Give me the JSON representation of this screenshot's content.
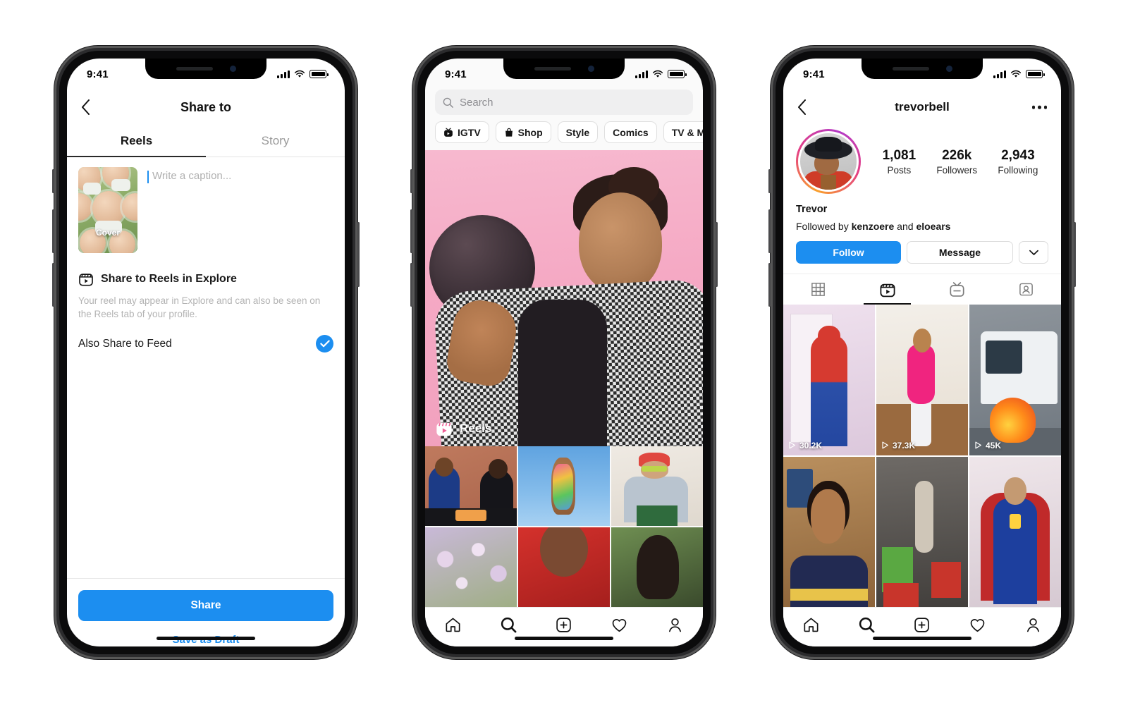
{
  "phones": [
    {
      "id": "share-to",
      "status": {
        "time": "9:41",
        "signal_icon": "cellular-bars-icon",
        "wifi_icon": "wifi-icon",
        "battery_icon": "battery-icon"
      },
      "nav": {
        "title": "Share to",
        "back_icon": "back-chevron-icon"
      },
      "tabs": [
        {
          "label": "Reels",
          "active": true
        },
        {
          "label": "Story",
          "active": false
        }
      ],
      "compose": {
        "cover_label": "Cover",
        "caption_placeholder": "Write a caption...",
        "caption_value": ""
      },
      "explore": {
        "icon": "reels-clapper-icon",
        "title": "Share to Reels in Explore",
        "description": "Your reel may appear in Explore and can also be seen on the Reels tab of your profile.",
        "feed_label": "Also Share to Feed",
        "feed_checked": true,
        "check_icon": "check-circle-icon"
      },
      "footer": {
        "share_label": "Share",
        "draft_label": "Save as Draft"
      }
    },
    {
      "id": "explore",
      "status": {
        "time": "9:41",
        "signal_icon": "cellular-bars-icon",
        "wifi_icon": "wifi-icon",
        "battery_icon": "battery-icon"
      },
      "search": {
        "placeholder": "Search",
        "value": "",
        "icon": "search-icon"
      },
      "chips": [
        {
          "label": "IGTV",
          "icon": "igtv-icon"
        },
        {
          "label": "Shop",
          "icon": "shop-bag-icon"
        },
        {
          "label": "Style",
          "icon": ""
        },
        {
          "label": "Comics",
          "icon": ""
        },
        {
          "label": "TV & Movies",
          "icon": ""
        }
      ],
      "hero": {
        "badge_label": "Reels",
        "badge_icon": "reels-clapper-icon",
        "alt": "person balancing basketball on finger against pink background"
      },
      "grid": [
        {
          "name": "thumb-brick-desk"
        },
        {
          "name": "thumb-glitter-hand-sky"
        },
        {
          "name": "thumb-denim-beanie"
        },
        {
          "name": "thumb-flowers"
        },
        {
          "name": "thumb-red"
        },
        {
          "name": "thumb-dark"
        }
      ],
      "tabbar": [
        {
          "icon": "home-icon",
          "active": false
        },
        {
          "icon": "search-icon",
          "active": true
        },
        {
          "icon": "add-box-icon",
          "active": false
        },
        {
          "icon": "heart-icon",
          "active": false
        },
        {
          "icon": "profile-icon",
          "active": false
        }
      ]
    },
    {
      "id": "profile",
      "status": {
        "time": "9:41",
        "signal_icon": "cellular-bars-icon",
        "wifi_icon": "wifi-icon",
        "battery_icon": "battery-icon"
      },
      "nav": {
        "username": "trevorbell",
        "back_icon": "back-chevron-icon",
        "more_icon": "more-options-icon"
      },
      "stats": [
        {
          "value": "1,081",
          "label": "Posts"
        },
        {
          "value": "226k",
          "label": "Followers"
        },
        {
          "value": "2,943",
          "label": "Following"
        }
      ],
      "bio": {
        "display_name": "Trevor",
        "followed_by_prefix": "Followed by ",
        "followed_by_user1": "kenzoere",
        "followed_by_join": " and ",
        "followed_by_user2": "eloears"
      },
      "actions": {
        "follow_label": "Follow",
        "message_label": "Message",
        "chevron_icon": "chevron-down-icon"
      },
      "profile_tabs": [
        {
          "icon": "grid-icon",
          "active": false
        },
        {
          "icon": "reels-clapper-icon",
          "active": true
        },
        {
          "icon": "igtv-icon",
          "active": false
        },
        {
          "icon": "tagged-person-icon",
          "active": false
        }
      ],
      "reels": [
        {
          "views": "30.2K",
          "name": "reel-spiderman"
        },
        {
          "views": "37.3K",
          "name": "reel-workout-dance"
        },
        {
          "views": "45K",
          "name": "reel-bus-flame"
        },
        {
          "views": "",
          "name": "reel-selfie-talking"
        },
        {
          "views": "",
          "name": "reel-gym-box-jump"
        },
        {
          "views": "",
          "name": "reel-superman-cosplay"
        }
      ],
      "tabbar": [
        {
          "icon": "home-icon",
          "active": false
        },
        {
          "icon": "search-icon",
          "active": true
        },
        {
          "icon": "add-box-icon",
          "active": false
        },
        {
          "icon": "heart-icon",
          "active": false
        },
        {
          "icon": "profile-icon",
          "active": false
        }
      ]
    }
  ],
  "colors": {
    "accent_blue": "#1c8ef0",
    "text_primary": "#111111",
    "text_muted": "#b3b3b3",
    "chip_border": "#e0e0e0"
  }
}
